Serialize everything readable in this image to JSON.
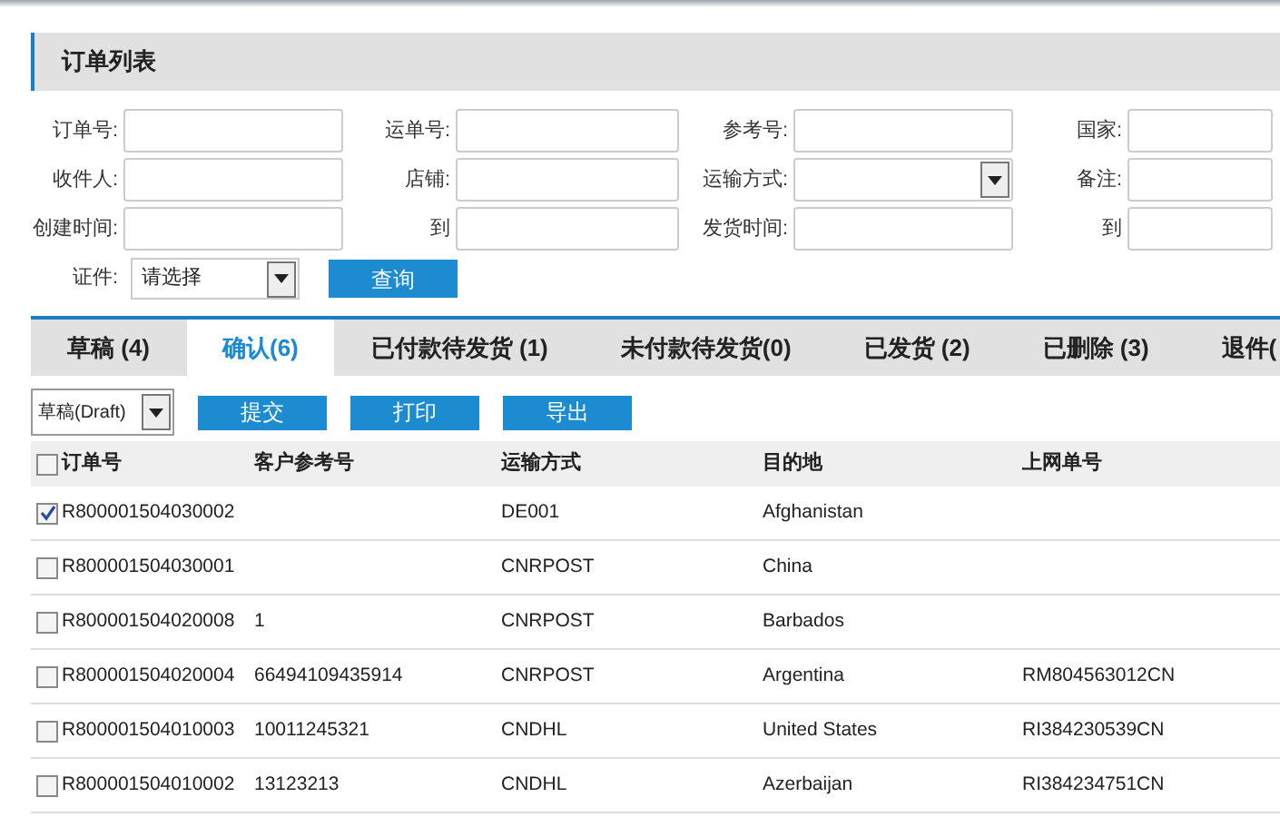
{
  "panel": {
    "title": "订单列表"
  },
  "filter_rows": [
    [
      {
        "label": "订单号:",
        "kind": "text"
      },
      {
        "label": "运单号:",
        "kind": "text"
      },
      {
        "label": "参考号:",
        "kind": "text"
      },
      {
        "label": "国家:",
        "kind": "text"
      }
    ],
    [
      {
        "label": "收件人:",
        "kind": "text"
      },
      {
        "label": "店铺:",
        "kind": "text"
      },
      {
        "label": "运输方式:",
        "kind": "select"
      },
      {
        "label": "备注:",
        "kind": "text"
      }
    ],
    [
      {
        "label": "创建时间:",
        "kind": "text"
      },
      {
        "label": "到",
        "kind": "text"
      },
      {
        "label": "发货时间:",
        "kind": "text"
      },
      {
        "label": "到",
        "kind": "text"
      }
    ]
  ],
  "certificate": {
    "label": "证件:",
    "value": "请选择"
  },
  "search_button": "查询",
  "tabs": [
    {
      "label": "草稿 (4)",
      "selected": false
    },
    {
      "label": "确认(6)",
      "selected": true
    },
    {
      "label": "已付款待发货 (1)",
      "selected": false
    },
    {
      "label": "未付款待发货(0)",
      "selected": false
    },
    {
      "label": "已发货 (2)",
      "selected": false
    },
    {
      "label": "已删除 (3)",
      "selected": false
    },
    {
      "label": "退件(",
      "selected": false
    }
  ],
  "toolbar": {
    "status_select": "草稿(Draft)",
    "buttons": [
      "提交",
      "打印",
      "导出"
    ]
  },
  "table": {
    "select_all_checked": false,
    "columns": [
      "订单号",
      "客户参考号",
      "运输方式",
      "目的地",
      "上网单号"
    ],
    "rows": [
      {
        "checked": true,
        "cells": [
          "R800001504030002",
          "",
          "DE001",
          "Afghanistan",
          ""
        ]
      },
      {
        "checked": false,
        "cells": [
          "R800001504030001",
          "",
          "CNRPOST",
          "China",
          ""
        ]
      },
      {
        "checked": false,
        "cells": [
          "R800001504020008",
          "1",
          "CNRPOST",
          "Barbados",
          ""
        ]
      },
      {
        "checked": false,
        "cells": [
          "R800001504020004",
          "66494109435914",
          "CNRPOST",
          "Argentina",
          "RM804563012CN"
        ]
      },
      {
        "checked": false,
        "cells": [
          "R800001504010003",
          "10011245321",
          "CNDHL",
          "United States",
          "RI384230539CN"
        ]
      },
      {
        "checked": false,
        "cells": [
          "R800001504010002",
          "13123213",
          "CNDHL",
          "Azerbaijan",
          "RI384234751CN"
        ]
      }
    ]
  }
}
